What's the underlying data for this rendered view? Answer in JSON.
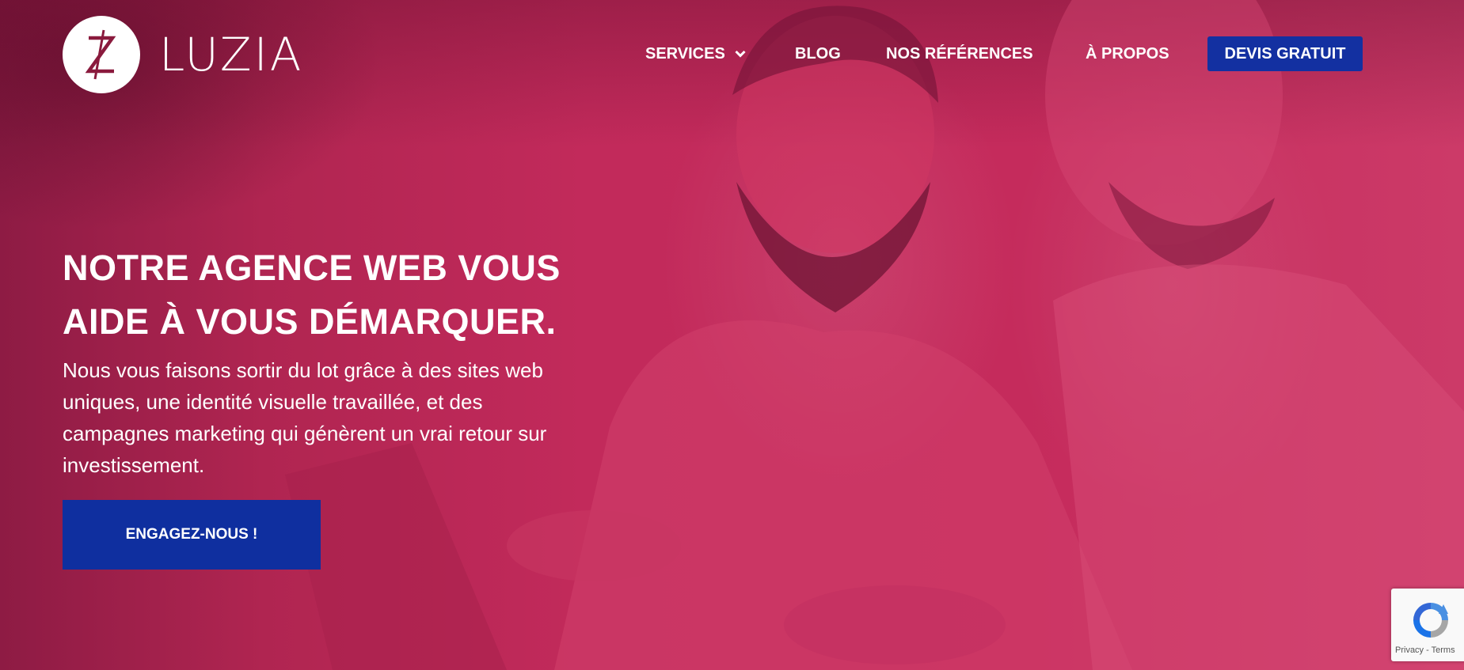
{
  "brand": {
    "name": "LUZIA"
  },
  "nav": {
    "items": [
      {
        "label": "SERVICES",
        "has_dropdown": true
      },
      {
        "label": "BLOG"
      },
      {
        "label": "NOS RÉFÉRENCES"
      },
      {
        "label": "À PROPOS"
      }
    ],
    "cta_label": "DEVIS GRATUIT"
  },
  "hero": {
    "headline_line1": "NOTRE AGENCE WEB VOUS",
    "headline_line2": "AIDE À VOUS DÉMARQUER.",
    "sub_line1": "Nous vous faisons sortir du lot grâce à des sites web",
    "sub_line2": "uniques, une identité visuelle travaillée, et des",
    "sub_line3": "campagnes marketing qui génèrent un vrai retour sur",
    "sub_line4": "investissement.",
    "cta_label": "ENGAGEZ-NOUS !"
  },
  "recaptcha": {
    "privacy": "Privacy",
    "separator": " - ",
    "terms": "Terms"
  },
  "colors": {
    "background_magenta": "#c52b5c",
    "button_blue": "#1330a1",
    "text": "#ffffff"
  },
  "icons": [
    "luzia-logo-icon",
    "chevron-down-icon",
    "recaptcha-icon"
  ]
}
